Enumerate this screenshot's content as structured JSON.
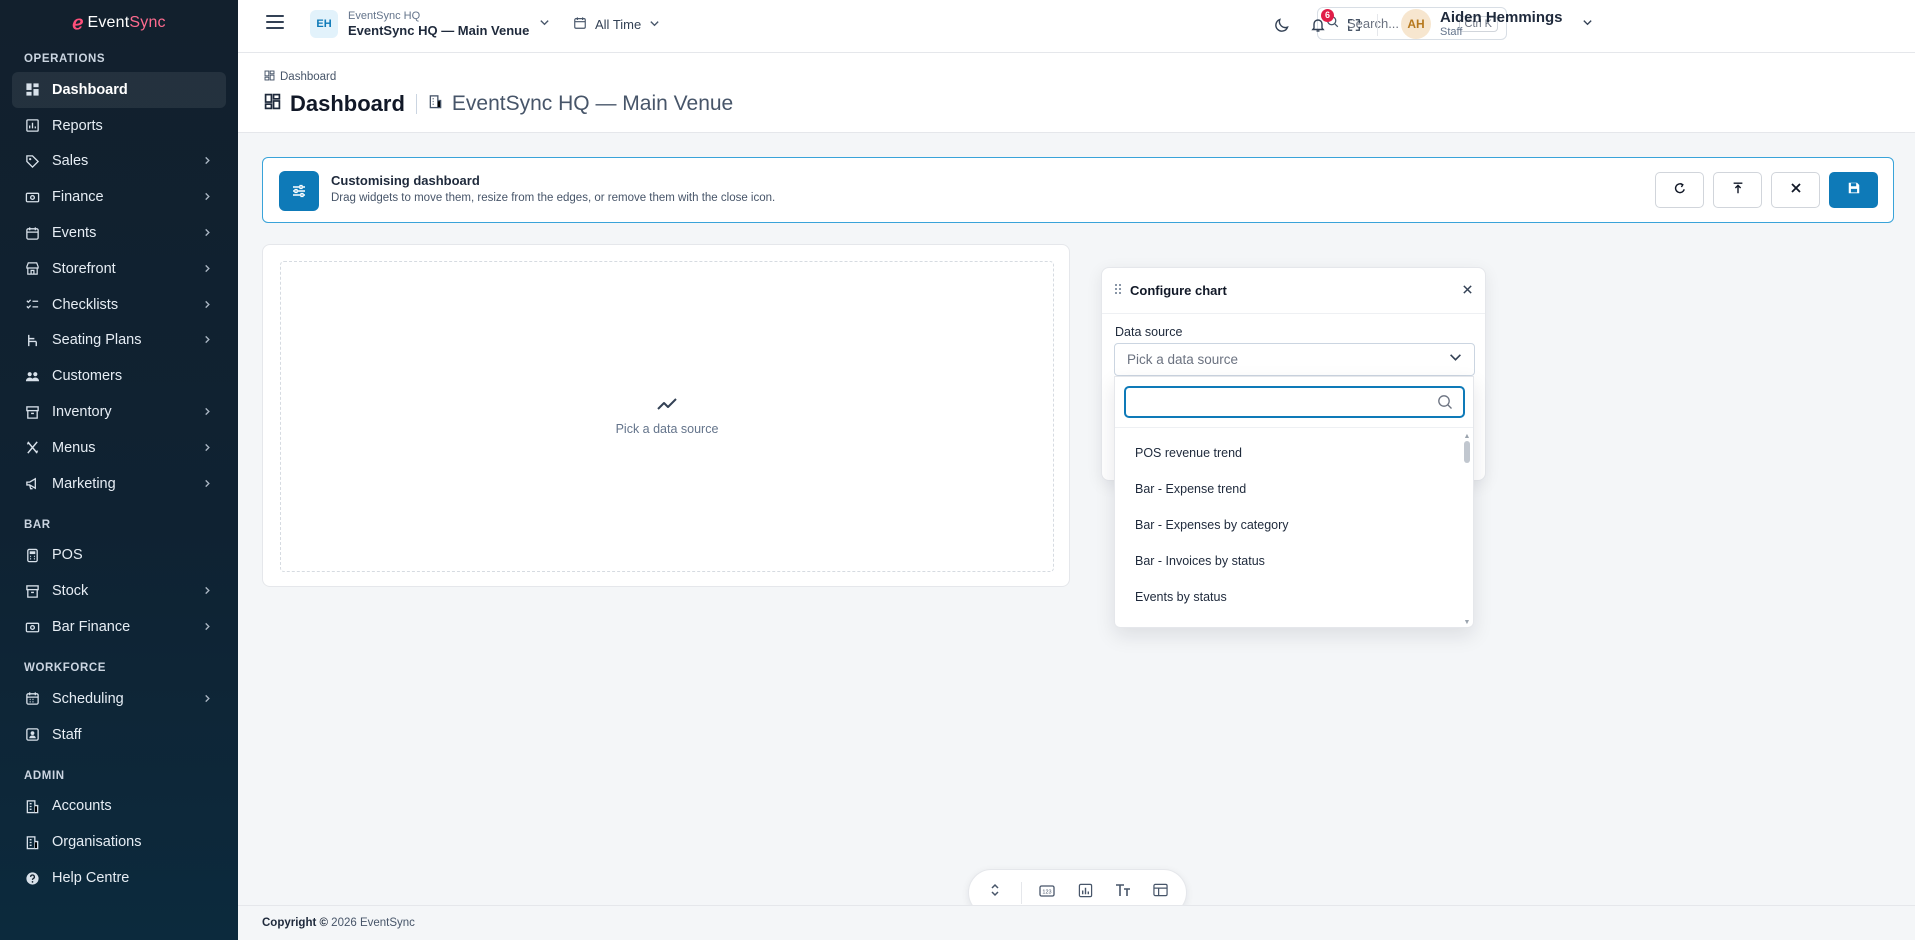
{
  "app": {
    "logo_text": "EventSync"
  },
  "sidebar": {
    "sections": [
      {
        "heading": "OPERATIONS",
        "items": [
          {
            "label": "Dashboard",
            "icon": "dashboard-icon",
            "active": true,
            "expandable": false
          },
          {
            "label": "Reports",
            "icon": "reports-icon",
            "expandable": false
          },
          {
            "label": "Sales",
            "icon": "tag-icon",
            "expandable": true
          },
          {
            "label": "Finance",
            "icon": "money-icon",
            "expandable": true
          },
          {
            "label": "Events",
            "icon": "events-icon",
            "expandable": true
          },
          {
            "label": "Storefront",
            "icon": "storefront-icon",
            "expandable": true
          },
          {
            "label": "Checklists",
            "icon": "checklist-icon",
            "expandable": true
          },
          {
            "label": "Seating Plans",
            "icon": "seating-icon",
            "expandable": true
          },
          {
            "label": "Customers",
            "icon": "customers-icon",
            "expandable": false
          },
          {
            "label": "Inventory",
            "icon": "inventory-icon",
            "expandable": true
          },
          {
            "label": "Menus",
            "icon": "menus-icon",
            "expandable": true
          },
          {
            "label": "Marketing",
            "icon": "megaphone-icon",
            "expandable": true
          }
        ]
      },
      {
        "heading": "BAR",
        "items": [
          {
            "label": "POS",
            "icon": "pos-icon",
            "expandable": false
          },
          {
            "label": "Stock",
            "icon": "stock-icon",
            "expandable": true
          },
          {
            "label": "Bar Finance",
            "icon": "money-icon",
            "expandable": true
          }
        ]
      },
      {
        "heading": "WORKFORCE",
        "items": [
          {
            "label": "Scheduling",
            "icon": "calendar-icon",
            "expandable": true
          },
          {
            "label": "Staff",
            "icon": "staff-icon",
            "expandable": false
          }
        ]
      },
      {
        "heading": "ADMIN",
        "items": [
          {
            "label": "Accounts",
            "icon": "accounts-icon",
            "expandable": false
          },
          {
            "label": "Organisations",
            "icon": "organisations-icon",
            "expandable": false
          },
          {
            "label": "Help Centre",
            "icon": "help-icon",
            "expandable": false
          }
        ]
      }
    ]
  },
  "topbar": {
    "org": {
      "initials": "EH",
      "small": "EventSync HQ",
      "name": "EventSync HQ — Main Venue"
    },
    "time_filter": "All Time",
    "search": {
      "placeholder": "Search...",
      "shortcut": "Ctrl K"
    },
    "notifications_count": "6",
    "user": {
      "initials": "AH",
      "name": "Aiden Hemmings",
      "role": "Staff"
    }
  },
  "page": {
    "breadcrumb": "Dashboard",
    "title": "Dashboard",
    "subtitle": "EventSync HQ — Main Venue"
  },
  "banner": {
    "title": "Customising dashboard",
    "description": "Drag widgets to move them, resize from the edges, or remove them with the close icon."
  },
  "widget": {
    "empty_text": "Pick a data source"
  },
  "config": {
    "title": "Configure chart",
    "data_source_label": "Data source",
    "data_source_placeholder": "Pick a data source",
    "search_value": "",
    "options": [
      "POS revenue trend",
      "Bar - Expense trend",
      "Bar - Expenses by category",
      "Bar - Invoices by status",
      "Events by status"
    ]
  },
  "footer": {
    "copyright_label": "Copyright ©",
    "copyright_rest": "2026 EventSync"
  },
  "colors": {
    "accent": "#0e7ab8",
    "sidebar_bg": "#12202d",
    "badge": "#e11d48"
  }
}
